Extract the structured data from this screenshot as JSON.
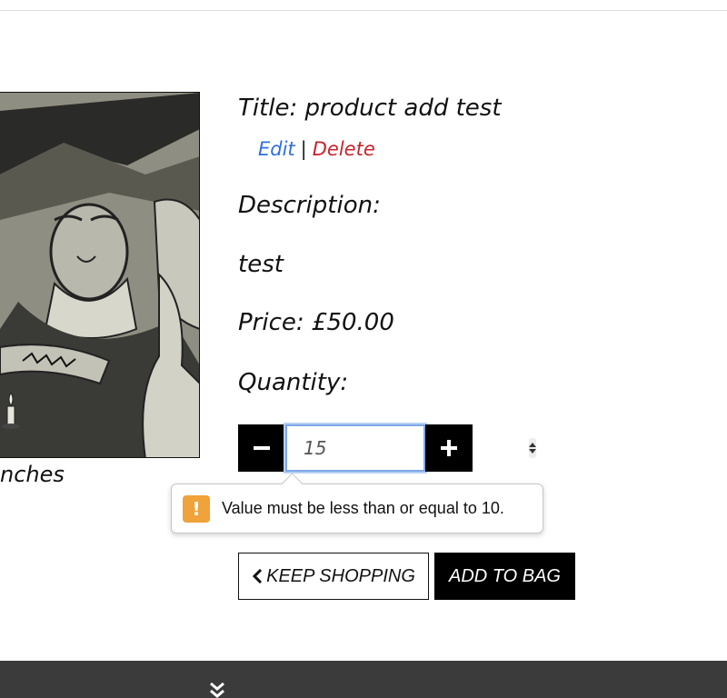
{
  "product": {
    "image_caption": "nches",
    "title": "Title: product add test",
    "edit_label": "Edit",
    "separator": "|",
    "delete_label": "Delete",
    "description_label": "Description:",
    "description": "test",
    "price": "Price: £50.00",
    "quantity_label": "Quantity:"
  },
  "quantity": {
    "value": "15",
    "decrement_icon": "minus-icon",
    "increment_icon": "plus-icon"
  },
  "validation": {
    "icon": "warning-icon",
    "message": "Value must be less than or equal to 10.",
    "icon_color": "#f0a23b"
  },
  "actions": {
    "keep_shopping": "KEEP SHOPPING",
    "add_to_bag": "ADD TO BAG"
  },
  "footer": {
    "icon": "double-chevron-down-icon",
    "background": "#3b3b3b"
  },
  "colors": {
    "edit_link": "#2f6fe0",
    "delete_link": "#c8232c",
    "focus_ring": "#7fa7e8"
  }
}
